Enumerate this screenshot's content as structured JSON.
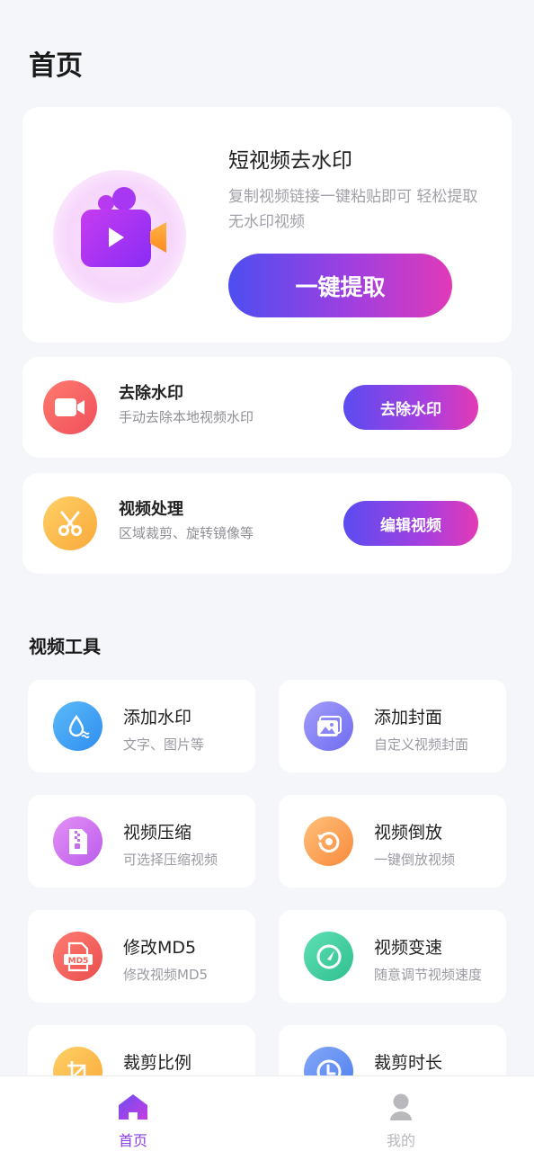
{
  "page_title": "首页",
  "hero": {
    "title": "短视频去水印",
    "description": "复制视频链接一键粘贴即可 轻松提取无水印视频",
    "button_label": "一键提取",
    "icon": "video-camera-icon"
  },
  "features": [
    {
      "title": "去除水印",
      "description": "手动去除本地视频水印",
      "button_label": "去除水印",
      "icon": "video-camera-icon",
      "color": "#f25f5f"
    },
    {
      "title": "视频处理",
      "description": "区域裁剪、旋转镜像等",
      "button_label": "编辑视频",
      "icon": "scissors-icon",
      "color": "#fbb43f"
    }
  ],
  "tools_section": {
    "title": "视频工具"
  },
  "tools": [
    {
      "title": "添加水印",
      "description": "文字、图片等",
      "icon": "watermark-drop-icon",
      "color": "#3ba1f2"
    },
    {
      "title": "添加封面",
      "description": "自定义视频封面",
      "icon": "image-cover-icon",
      "color": "#8a86f5"
    },
    {
      "title": "视频压缩",
      "description": "可选择压缩视频",
      "icon": "zip-file-icon",
      "color": "#d16cf0"
    },
    {
      "title": "视频倒放",
      "description": "一键倒放视频",
      "icon": "rewind-circle-icon",
      "color": "#fb9a4a"
    },
    {
      "title": "修改MD5",
      "description": "修改视频MD5",
      "icon": "md5-file-icon",
      "color": "#f2605a"
    },
    {
      "title": "视频变速",
      "description": "随意调节视频速度",
      "icon": "speed-gauge-icon",
      "color": "#3ed0a0"
    },
    {
      "title": "裁剪比例",
      "description": "",
      "icon": "crop-icon",
      "color": "#fbb43f"
    },
    {
      "title": "裁剪时长",
      "description": "",
      "icon": "clock-icon",
      "color": "#5b8ef2"
    }
  ],
  "tabbar": {
    "items": [
      {
        "label": "首页",
        "icon": "home-icon",
        "active": true,
        "color": "#8a3fe0"
      },
      {
        "label": "我的",
        "icon": "user-icon",
        "active": false,
        "color": "#b8b8bd"
      }
    ]
  }
}
